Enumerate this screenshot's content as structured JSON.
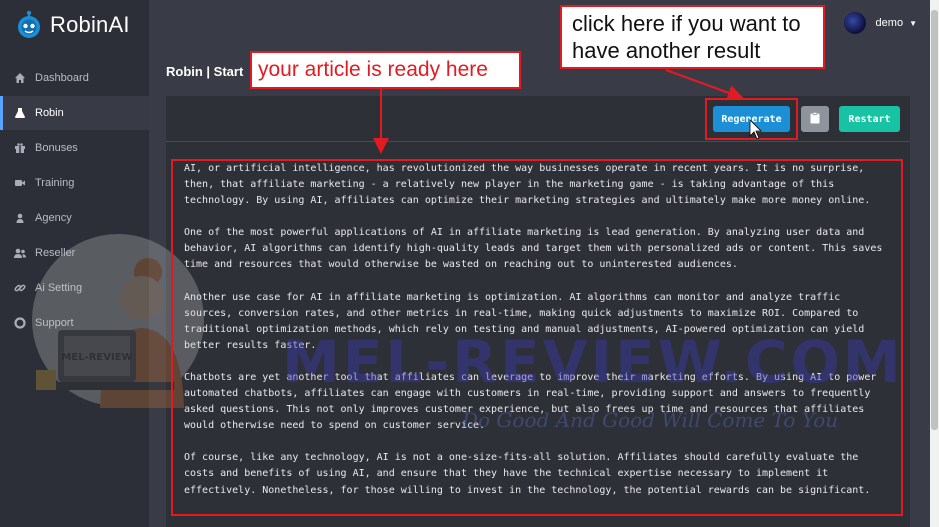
{
  "brand": {
    "name": "RobinAI",
    "accent": "#1a8fd8"
  },
  "sidebar": {
    "items": [
      {
        "label": "Dashboard",
        "icon": "home-icon"
      },
      {
        "label": "Robin",
        "icon": "flask-icon",
        "active": true
      },
      {
        "label": "Bonuses",
        "icon": "gift-icon"
      },
      {
        "label": "Training",
        "icon": "video-icon"
      },
      {
        "label": "Agency",
        "icon": "user-icon"
      },
      {
        "label": "Reseller",
        "icon": "users-icon"
      },
      {
        "label": "Ai Setting",
        "icon": "link-icon"
      },
      {
        "label": "Support",
        "icon": "lifebuoy-icon"
      }
    ]
  },
  "user": {
    "name": "demo"
  },
  "page": {
    "title": "Robin | Start"
  },
  "toolbar": {
    "regenerate_label": "Regenerate",
    "copy_icon": "clipboard-icon",
    "restart_label": "Restart"
  },
  "article": {
    "paragraphs": [
      "AI, or artificial intelligence, has revolutionized the way businesses operate in recent years. It is no surprise, then, that affiliate marketing - a relatively new player in the marketing game - is taking advantage of this technology. By using AI, affiliates can optimize their marketing strategies and ultimately make more money online.",
      "One of the most powerful applications of AI in affiliate marketing is lead generation. By analyzing user data and behavior, AI algorithms can identify high-quality leads and target them with personalized ads or content. This saves time and resources that would otherwise be wasted on reaching out to uninterested audiences.",
      "Another use case for AI in affiliate marketing is optimization. AI algorithms can monitor and analyze traffic sources, conversion rates, and other metrics in real-time, making quick adjustments to maximize ROI. Compared to traditional optimization methods, which rely on testing and manual adjustments, AI-powered optimization can yield better results faster.",
      "Chatbots are yet another tool that affiliates can leverage to improve their marketing efforts. By using AI to power automated chatbots, affiliates can engage with customers in real-time, providing support and answers to frequently asked questions. This not only improves customer experience, but also frees up time and resources that affiliates would otherwise need to spend on customer service.",
      "Of course, like any technology, AI is not a one-size-fits-all solution. Affiliates should carefully evaluate the costs and benefits of using AI, and ensure that they have the technical expertise necessary to implement it effectively. Nonetheless, for those willing to invest in the technology, the potential rewards can be significant."
    ]
  },
  "annotations": {
    "article_ready": "your article is ready here",
    "regenerate_hint": "click here if you want to have another result",
    "color": "#e21b22"
  },
  "watermark": {
    "main": "MEL-REVIEW.COM",
    "sub": "Do Good And Good Will Come To You",
    "laptop_text": "MEL-REVIEW"
  }
}
